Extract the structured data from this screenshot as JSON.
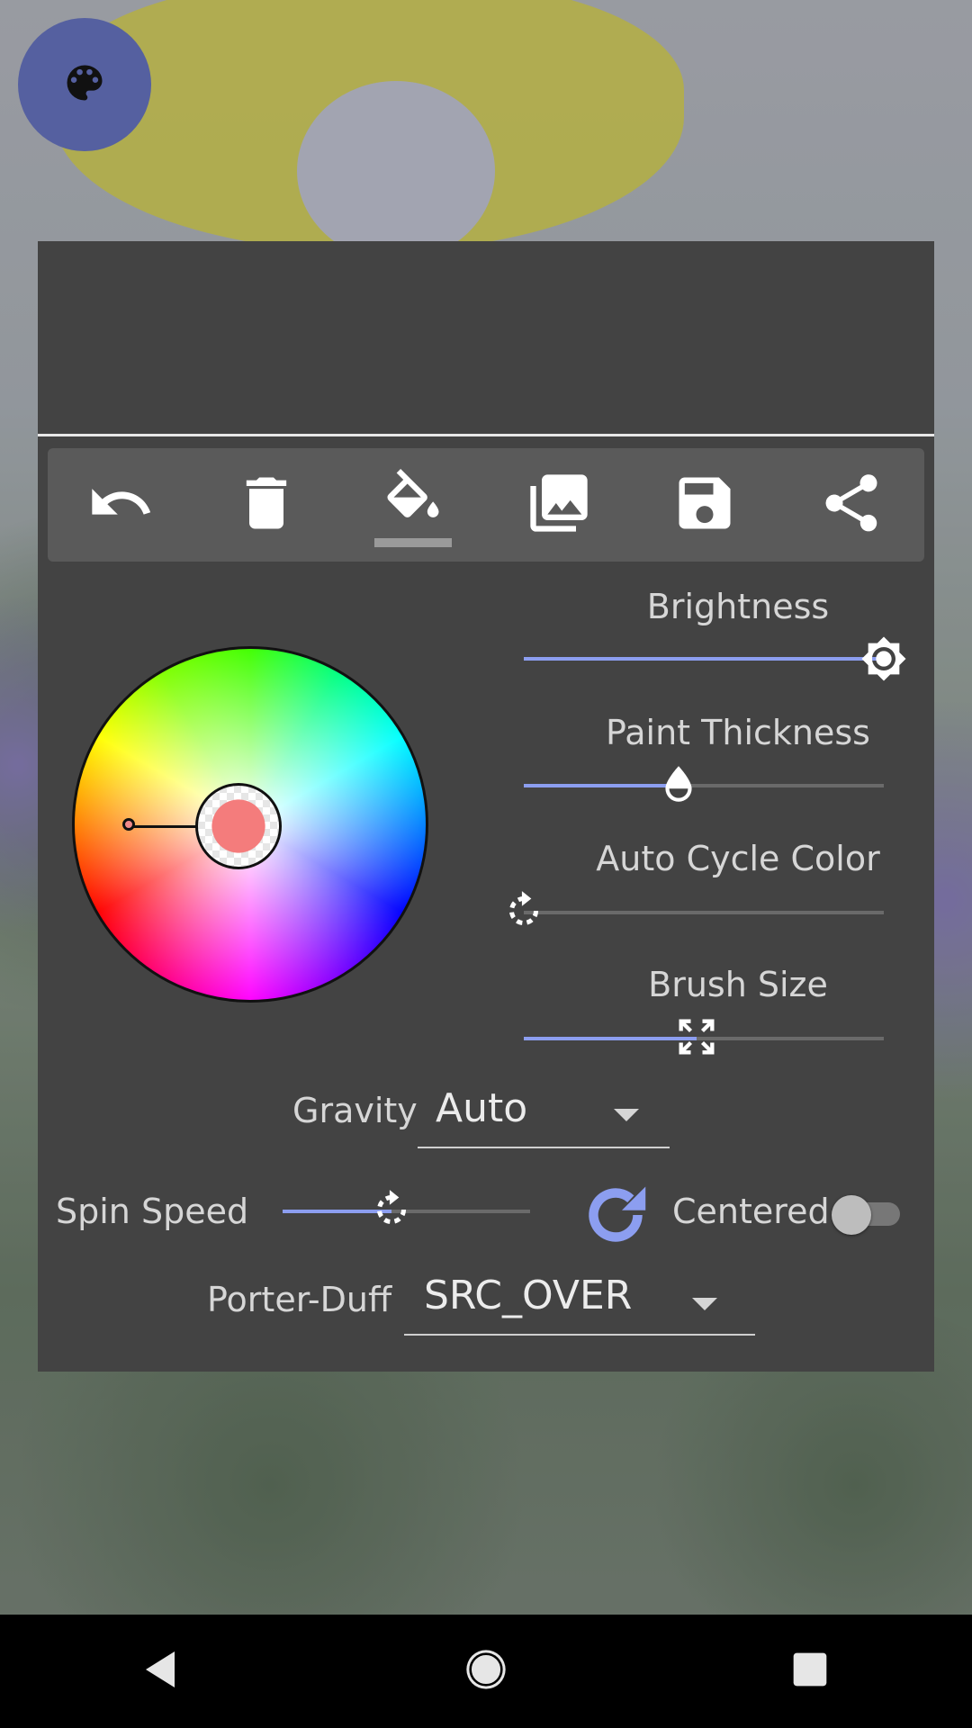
{
  "app": {
    "fab_icon": "palette-icon",
    "accent_color": "#8c9ef0",
    "toolbar": {
      "items": [
        {
          "name": "undo",
          "icon": "undo-icon"
        },
        {
          "name": "clear",
          "icon": "trash-icon"
        },
        {
          "name": "fill",
          "icon": "paint-bucket-icon",
          "selected": true
        },
        {
          "name": "gallery",
          "icon": "gallery-icon"
        },
        {
          "name": "save",
          "icon": "save-icon"
        },
        {
          "name": "share",
          "icon": "share-icon"
        }
      ]
    },
    "color_picker": {
      "selected_color": "#f47c7c"
    },
    "sliders": {
      "brightness": {
        "label": "Brightness",
        "value": 1.0
      },
      "paint_thickness": {
        "label": "Paint Thickness",
        "value": 0.43
      },
      "auto_cycle_color": {
        "label": "Auto Cycle Color",
        "value": 0.0
      },
      "brush_size": {
        "label": "Brush Size",
        "value": 0.48
      }
    },
    "gravity": {
      "label": "Gravity",
      "value": "Auto"
    },
    "spin_speed": {
      "label": "Spin Speed",
      "value": 0.44
    },
    "centered": {
      "label": "Centered",
      "on": false
    },
    "porter_duff": {
      "label": "Porter-Duff",
      "value": "SRC_OVER"
    }
  }
}
